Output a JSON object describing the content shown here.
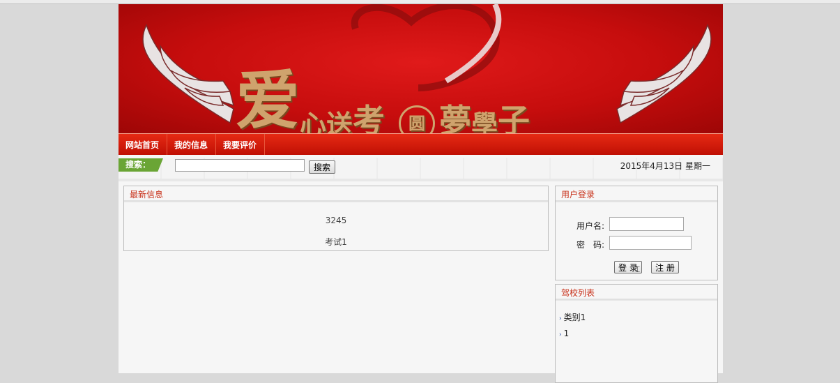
{
  "banner": {
    "char_big": "爱",
    "chars_a": "心送",
    "char_b": "考",
    "char_circle": "圆",
    "char_c": "夢",
    "char_d": "學",
    "char_e": "子"
  },
  "nav": {
    "items": [
      {
        "label": "网站首页"
      },
      {
        "label": "我的信息"
      },
      {
        "label": "我要评价"
      }
    ]
  },
  "search": {
    "tag_label": "搜索：",
    "input_value": "",
    "button_label": "搜索",
    "date_text": "2015年4月13日 星期一"
  },
  "news": {
    "title": "最新信息",
    "items": [
      "3245",
      "考试1"
    ]
  },
  "login": {
    "title": "用户登录",
    "username_label": "用户名:",
    "password_label": "密　码:",
    "username_value": "",
    "password_value": "",
    "login_button": "登 录",
    "register_button": "注 册"
  },
  "schools": {
    "title": "驾校列表",
    "items": [
      "类别1",
      "1"
    ]
  },
  "colors": {
    "nav_red": "#d41c0a",
    "title_red": "#c8311a",
    "search_green": "#6aa535"
  }
}
